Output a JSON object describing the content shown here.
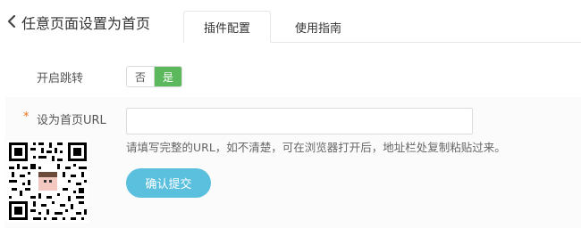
{
  "header": {
    "back_icon": "chevron-left-icon",
    "title": "任意页面设置为首页"
  },
  "tabs": [
    {
      "label": "插件配置",
      "active": true
    },
    {
      "label": "使用指南",
      "active": false
    }
  ],
  "form": {
    "redirect": {
      "label": "开启跳转",
      "options": [
        "否",
        "是"
      ],
      "selected": "是"
    },
    "homepage_url": {
      "required_mark": "*",
      "label": "设为首页URL",
      "value": "",
      "placeholder": "",
      "hint": "请填写完整的URL，如不清楚，可在浏览器打开后，地址栏处复制粘贴过来。"
    },
    "submit_label": "确认提交"
  },
  "colors": {
    "switch_on": "#5cb85c",
    "submit_button": "#5bc0de",
    "required_star": "#e8731e"
  },
  "qr_code": {
    "icon": "qr-code-icon"
  }
}
